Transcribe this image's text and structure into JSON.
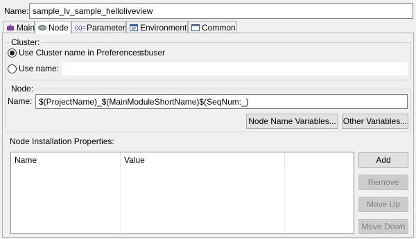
{
  "name_row": {
    "label": "Name:",
    "value": "sample_lv_sample_helloliveview"
  },
  "tabs": [
    {
      "label": "Main",
      "icon": "main-icon",
      "selected": false
    },
    {
      "label": "Node",
      "icon": "node-icon",
      "selected": true
    },
    {
      "label": "Parameters",
      "icon": "parameters-icon",
      "selected": false
    },
    {
      "label": "Environment",
      "icon": "environment-icon",
      "selected": false
    },
    {
      "label": "Common",
      "icon": "common-icon",
      "selected": false
    }
  ],
  "cluster": {
    "legend": "Cluster:",
    "use_cluster_label": "Use Cluster name in Preferences:",
    "cluster_name": "sbuser",
    "use_name_label": "Use name:",
    "use_name_value": "",
    "selected_option": "use_cluster"
  },
  "node": {
    "legend": "Node:",
    "name_label": "Name:",
    "name_value": "$(ProjectName)_$(MainModuleShortName)$(SeqNum:_)",
    "node_name_variables_button": "Node Name Variables...",
    "other_variables_button": "Other Variables..."
  },
  "installation": {
    "label": "Node Installation Properties:",
    "columns": [
      "Name",
      "Value"
    ],
    "rows": [],
    "buttons": {
      "add": "Add",
      "remove": "Remove",
      "move_up": "Move Up",
      "move_down": "Move Down"
    }
  },
  "colors": {
    "panel_bg": "#f0f0f0",
    "table_border": "#828790",
    "disabled_text": "#838383"
  }
}
